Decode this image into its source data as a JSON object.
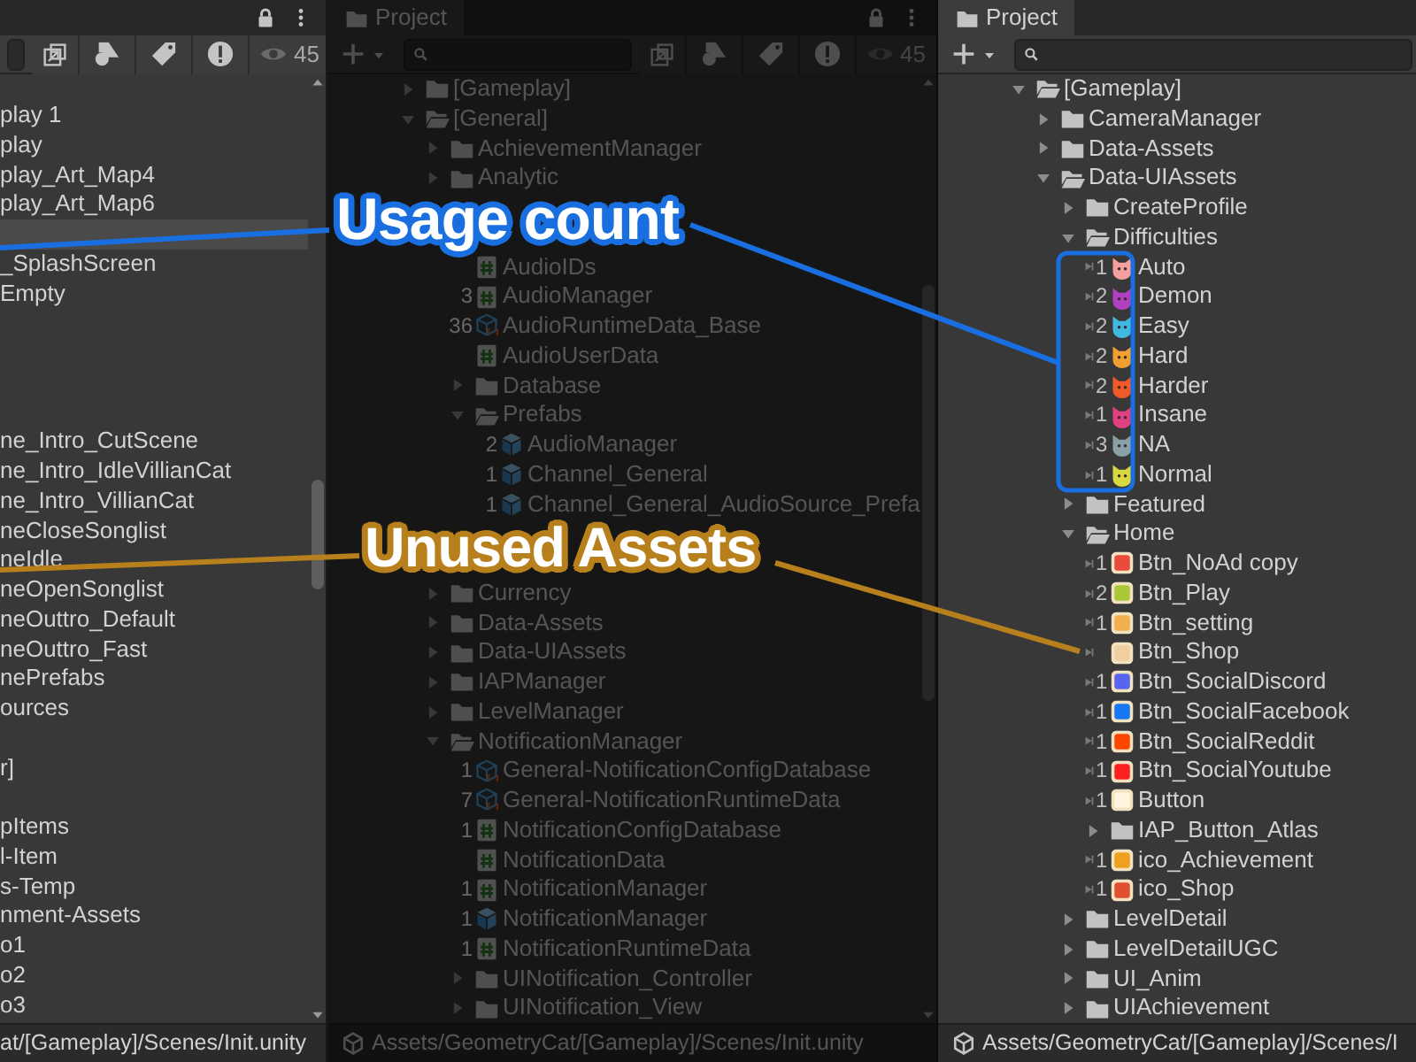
{
  "left_panel": {
    "hidden_count": "45",
    "rows": [
      {
        "label": "play 1",
        "selected": false
      },
      {
        "label": "play",
        "selected": false
      },
      {
        "label": "play_Art_Map4",
        "selected": false
      },
      {
        "label": "play_Art_Map6",
        "selected": false
      },
      {
        "selected": true
      },
      {
        "label": "_SplashScreen",
        "selected": false
      },
      {
        "label": "Empty",
        "selected": false
      },
      {
        "selected": false
      },
      {
        "selected": false
      },
      {
        "selected": false
      },
      {
        "selected": false
      },
      {
        "label": "ne_Intro_CutScene",
        "selected": false
      },
      {
        "label": "ne_Intro_IdleVillianCat",
        "selected": false
      },
      {
        "label": "ne_Intro_VillianCat",
        "selected": false
      },
      {
        "label": "neCloseSonglist",
        "selected": false
      },
      {
        "label": "neIdle",
        "selected": false
      },
      {
        "label": "neOpenSonglist",
        "selected": false
      },
      {
        "label": "neOuttro_Default",
        "selected": false
      },
      {
        "label": "neOuttro_Fast",
        "selected": false
      },
      {
        "label": "nePrefabs",
        "selected": false
      },
      {
        "label": "ources",
        "selected": false
      },
      {
        "selected": false
      },
      {
        "label": "r]",
        "selected": false
      },
      {
        "selected": false
      },
      {
        "label": "pItems",
        "selected": false
      },
      {
        "label": "l-Item",
        "selected": false
      },
      {
        "label": "s-Temp",
        "selected": false
      },
      {
        "label": "nment-Assets",
        "selected": false
      },
      {
        "label": "o1",
        "selected": false
      },
      {
        "label": "o2",
        "selected": false
      },
      {
        "label": "o3",
        "selected": false
      }
    ],
    "status_path": "at/[Gameplay]/Scenes/Init.unity"
  },
  "middle_panel": {
    "tab": "Project",
    "hidden_count": "45",
    "tree": [
      {
        "label": "[Gameplay]",
        "kind": "folder",
        "expanded": false
      },
      {
        "label": "[General]",
        "kind": "folder",
        "expanded": true,
        "children": [
          {
            "label": "AchievementManager",
            "kind": "folder",
            "expanded": false
          },
          {
            "label": "Analytic",
            "kind": "folder",
            "expanded": false
          },
          {
            "kind": "folder",
            "children": [
              {
                "kind": "covered"
              },
              {
                "label": "AudioIDs",
                "kind": "script"
              },
              {
                "label": "AudioManager",
                "kind": "script",
                "count": "3"
              },
              {
                "label": "AudioRuntimeData_Base",
                "kind": "data-asset",
                "count": "36"
              },
              {
                "label": "AudioUserData",
                "kind": "script"
              },
              {
                "label": "Database",
                "kind": "folder",
                "expanded": false
              },
              {
                "label": "Prefabs",
                "kind": "folder",
                "expanded": true,
                "children": [
                  {
                    "label": "AudioManager",
                    "kind": "prefab",
                    "count": "2"
                  },
                  {
                    "label": "Channel_General",
                    "kind": "prefab",
                    "count": "1"
                  },
                  {
                    "label": "Channel_General_AudioSource_Prefa",
                    "kind": "prefab",
                    "count": "1"
                  }
                ]
              }
            ]
          },
          {
            "kind": "covered"
          },
          {
            "kind": "covered"
          },
          {
            "label": "Currency",
            "kind": "folder",
            "expanded": false
          },
          {
            "label": "Data-Assets",
            "kind": "folder",
            "expanded": false
          },
          {
            "label": "Data-UIAssets",
            "kind": "folder",
            "expanded": false
          },
          {
            "label": "IAPManager",
            "kind": "folder",
            "expanded": false
          },
          {
            "label": "LevelManager",
            "kind": "folder",
            "expanded": false
          },
          {
            "label": "NotificationManager",
            "kind": "folder",
            "expanded": true,
            "children": [
              {
                "label": "General-NotificationConfigDatabase",
                "kind": "data-asset",
                "count": "1"
              },
              {
                "label": "General-NotificationRuntimeData",
                "kind": "data-asset",
                "count": "7"
              },
              {
                "label": "NotificationConfigDatabase",
                "kind": "script",
                "count": "1"
              },
              {
                "label": "NotificationData",
                "kind": "script"
              },
              {
                "label": "NotificationManager",
                "kind": "script",
                "count": "1"
              },
              {
                "label": "NotificationManager",
                "kind": "prefab",
                "count": "1"
              },
              {
                "label": "NotificationRuntimeData",
                "kind": "script",
                "count": "1"
              },
              {
                "label": "UINotification_Controller",
                "kind": "folder",
                "expanded": false
              },
              {
                "label": "UINotification_View",
                "kind": "folder",
                "expanded": false
              }
            ]
          }
        ]
      }
    ],
    "status_path": "Assets/GeometryCat/[Gameplay]/Scenes/Init.unity"
  },
  "right_panel": {
    "tab": "Project",
    "tree": [
      {
        "label": "[Gameplay]",
        "kind": "folder",
        "expanded": true,
        "children": [
          {
            "label": "CameraManager",
            "kind": "folder",
            "expanded": false
          },
          {
            "label": "Data-Assets",
            "kind": "folder",
            "expanded": false
          },
          {
            "label": "Data-UIAssets",
            "kind": "folder",
            "expanded": true,
            "children": [
              {
                "label": "CreateProfile",
                "kind": "folder",
                "expanded": false
              },
              {
                "label": "Difficulties",
                "kind": "folder",
                "expanded": true,
                "children": [
                  {
                    "label": "Auto",
                    "kind": "cat",
                    "count": "1",
                    "color": "#f4a0a0"
                  },
                  {
                    "label": "Demon",
                    "kind": "cat",
                    "count": "2",
                    "color": "#b040c0"
                  },
                  {
                    "label": "Easy",
                    "kind": "cat",
                    "count": "2",
                    "color": "#40b8e0"
                  },
                  {
                    "label": "Hard",
                    "kind": "cat",
                    "count": "2",
                    "color": "#f0a030"
                  },
                  {
                    "label": "Harder",
                    "kind": "cat",
                    "count": "2",
                    "color": "#f05a28"
                  },
                  {
                    "label": "Insane",
                    "kind": "cat",
                    "count": "1",
                    "color": "#e04080"
                  },
                  {
                    "label": "NA",
                    "kind": "cat",
                    "count": "3",
                    "color": "#8aa0a8"
                  },
                  {
                    "label": "Normal",
                    "kind": "cat",
                    "count": "1",
                    "color": "#d8d840"
                  }
                ]
              },
              {
                "label": "Featured",
                "kind": "folder",
                "expanded": false
              },
              {
                "label": "Home",
                "kind": "folder",
                "expanded": true,
                "children": [
                  {
                    "label": "Btn_NoAd copy",
                    "kind": "sprite",
                    "count": "1",
                    "color": "#e84a3c"
                  },
                  {
                    "label": "Btn_Play",
                    "kind": "sprite",
                    "count": "2",
                    "color": "#a8c838"
                  },
                  {
                    "label": "Btn_setting",
                    "kind": "sprite",
                    "count": "1",
                    "color": "#f0b050"
                  },
                  {
                    "label": "Btn_Shop",
                    "kind": "sprite",
                    "color": "#f0d0a0"
                  },
                  {
                    "label": "Btn_SocialDiscord",
                    "kind": "sprite",
                    "count": "1",
                    "color": "#5865f2"
                  },
                  {
                    "label": "Btn_SocialFacebook",
                    "kind": "sprite",
                    "count": "1",
                    "color": "#1877f2"
                  },
                  {
                    "label": "Btn_SocialReddit",
                    "kind": "sprite",
                    "count": "1",
                    "color": "#ff4500"
                  },
                  {
                    "label": "Btn_SocialYoutube",
                    "kind": "sprite",
                    "count": "1",
                    "color": "#ff2020"
                  },
                  {
                    "label": "Button",
                    "kind": "sprite",
                    "count": "1",
                    "color": "#fff4dc"
                  },
                  {
                    "label": "IAP_Button_Atlas",
                    "kind": "folder",
                    "expanded": false
                  },
                  {
                    "label": "ico_Achievement",
                    "kind": "sprite",
                    "count": "1",
                    "color": "#f0a020"
                  },
                  {
                    "label": "ico_Shop",
                    "kind": "sprite",
                    "count": "1",
                    "color": "#e05030"
                  }
                ]
              },
              {
                "label": "LevelDetail",
                "kind": "folder",
                "expanded": false
              },
              {
                "label": "LevelDetailUGC",
                "kind": "folder",
                "expanded": false
              },
              {
                "label": "UI_Anim",
                "kind": "folder",
                "expanded": false
              },
              {
                "label": "UIAchievement",
                "kind": "folder",
                "expanded": false
              }
            ]
          }
        ]
      }
    ],
    "status_path": "Assets/GeometryCat/[Gameplay]/Scenes/I"
  },
  "callouts": [
    {
      "text": "Usage count",
      "color": "#1a6fe0"
    },
    {
      "text": "Unused Assets",
      "color": "#b8801c"
    }
  ]
}
